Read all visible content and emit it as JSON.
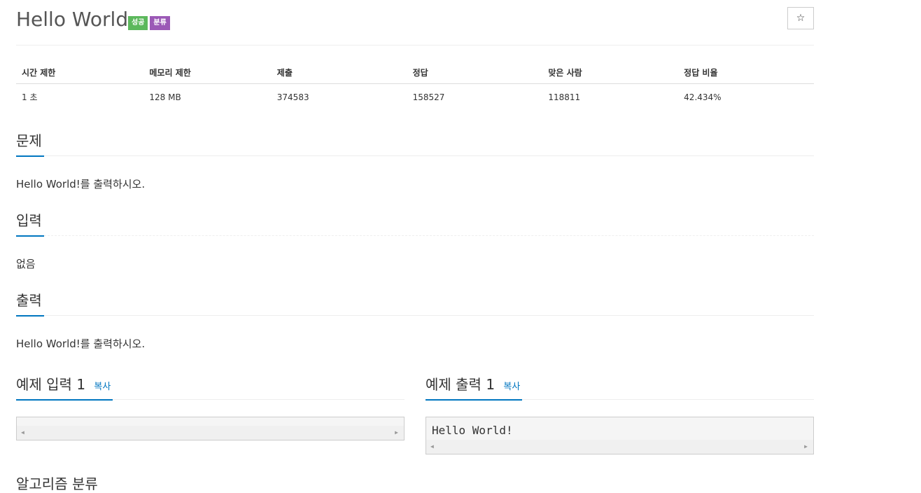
{
  "problem": {
    "title": "Hello World",
    "labels": [
      {
        "text": "성공",
        "color": "#5cb85c"
      },
      {
        "text": "분류",
        "color": "#9b59b6"
      }
    ],
    "star": "☆"
  },
  "stats": {
    "headers": [
      "시간 제한",
      "메모리 제한",
      "제출",
      "정답",
      "맞은 사람",
      "정답 비율"
    ],
    "values": [
      "1 초",
      "128 MB",
      "374583",
      "158527",
      "118811",
      "42.434%"
    ]
  },
  "sections": {
    "description": {
      "title": "문제",
      "body": "Hello World!를 출력하시오."
    },
    "input": {
      "title": "입력",
      "body": "없음"
    },
    "output": {
      "title": "출력",
      "body": "Hello World!를 출력하시오."
    }
  },
  "samples": {
    "input1": {
      "title": "예제 입력 1",
      "copy": "복사",
      "content": ""
    },
    "output1": {
      "title": "예제 출력 1",
      "copy": "복사",
      "content": "Hello World!"
    }
  },
  "next_section_title": "알고리즘 분류",
  "colors": {
    "accent": "#0076c0",
    "success_label": "#5cb85c",
    "category_label": "#9b59b6"
  }
}
